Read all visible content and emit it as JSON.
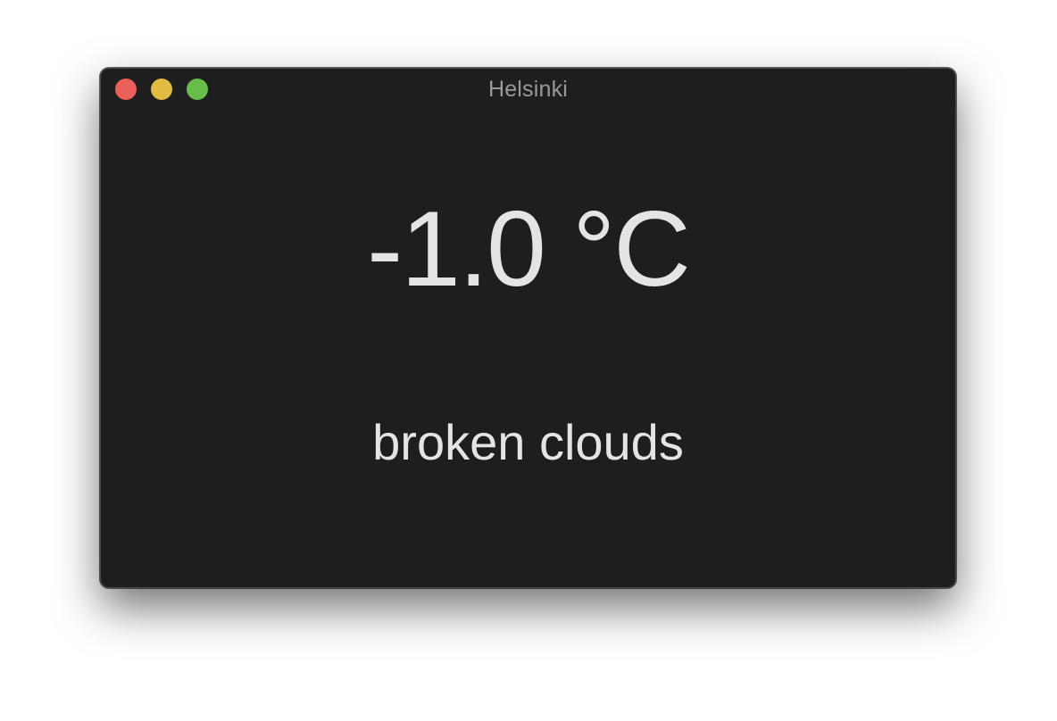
{
  "window": {
    "title": "Helsinki",
    "controls": {
      "close": {
        "icon": "close-traffic-light-icon",
        "color": "#ec5f5a"
      },
      "minimize": {
        "icon": "minimize-traffic-light-icon",
        "color": "#e2bc42"
      },
      "zoom": {
        "icon": "zoom-traffic-light-icon",
        "color": "#67be49"
      }
    },
    "background": "#1e1e1e"
  },
  "weather": {
    "temperature": "-1.0 °C",
    "description": "broken clouds",
    "text_color": "#e4e4e4"
  }
}
